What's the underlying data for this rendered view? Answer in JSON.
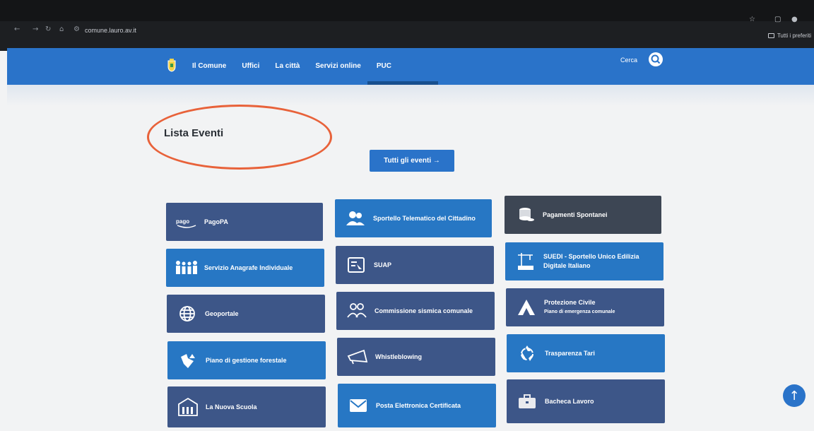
{
  "browser": {
    "url": "comune.lauro.av.it",
    "bookmarks_label": "Tutti i preferiti"
  },
  "header": {
    "menu": [
      "Il Comune",
      "Uffici",
      "La città",
      "Servizi online",
      "PUC"
    ],
    "search_label": "Cerca"
  },
  "main": {
    "title": "Lista Eventi",
    "all_events_button": "Tutti gli eventi →"
  },
  "tiles": [
    {
      "label": "PagoPA",
      "sub": "",
      "icon": "pagopa-icon"
    },
    {
      "label": "Sportello Telematico del Cittadino",
      "sub": "",
      "icon": "people-icon"
    },
    {
      "label": "Pagamenti Spontanei",
      "sub": "",
      "icon": "coins-icon"
    },
    {
      "label": "Servizio Anagrafe Individuale",
      "sub": "",
      "icon": "family-icon"
    },
    {
      "label": "SUAP",
      "sub": "",
      "icon": "suap-icon"
    },
    {
      "label": "SUEDI - Sportello Unico Edilizia Digitale Italiano",
      "sub": "",
      "icon": "crane-icon"
    },
    {
      "label": "Geoportale",
      "sub": "",
      "icon": "globe-icon"
    },
    {
      "label": "Commissione sismica comunale",
      "sub": "",
      "icon": "people-icon"
    },
    {
      "label": "Protezione Civile",
      "sub": "Piano di emergenza comunale",
      "icon": "civil-protection-icon"
    },
    {
      "label": "Piano di gestione forestale",
      "sub": "",
      "icon": "forest-icon"
    },
    {
      "label": "Whistleblowing",
      "sub": "",
      "icon": "megaphone-icon"
    },
    {
      "label": "Trasparenza Tari",
      "sub": "",
      "icon": "recycle-icon"
    },
    {
      "label": "La Nuova Scuola",
      "sub": "",
      "icon": "school-icon"
    },
    {
      "label": "Posta Elettronica Certificata",
      "sub": "",
      "icon": "mail-icon"
    },
    {
      "label": "Bacheca Lavoro",
      "sub": "",
      "icon": "briefcase-icon"
    }
  ],
  "colors": {
    "header_blue": "#2a73c9",
    "tile_dark": "#3d5688",
    "tile_blue": "#2777c4",
    "tile_slate": "#3d4654",
    "highlight_circle": "#e8623a"
  }
}
